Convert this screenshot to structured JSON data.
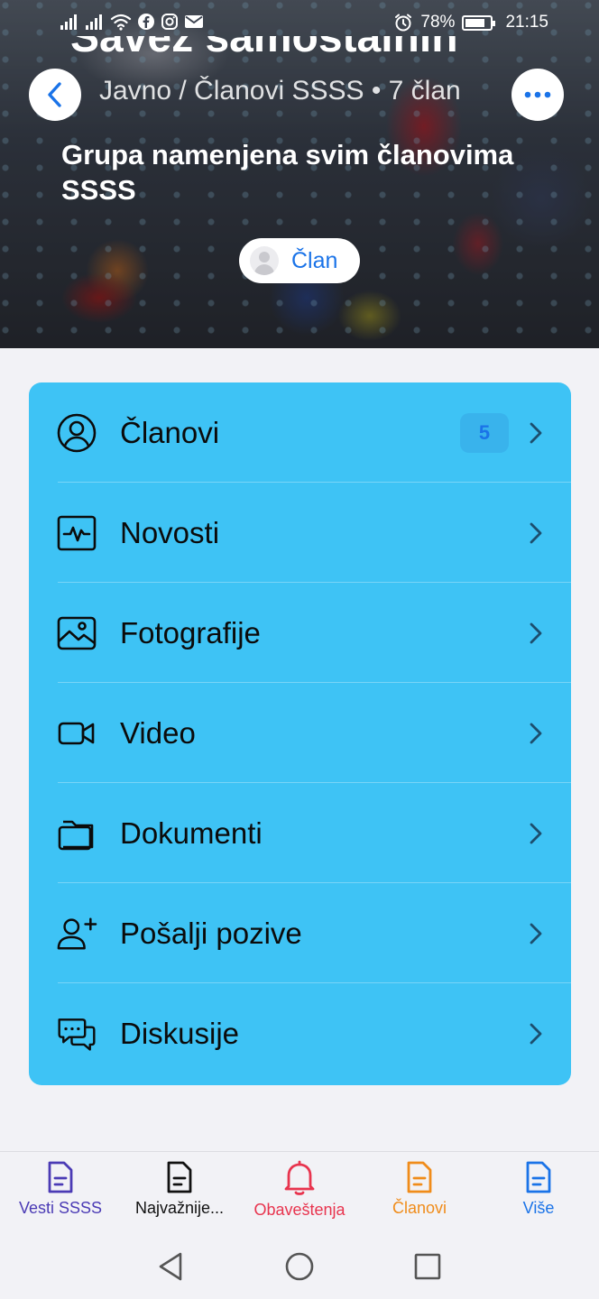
{
  "status_bar": {
    "battery_percent": "78%",
    "battery_level": 0.78,
    "time": "21:15",
    "icons": [
      "signal-icon",
      "signal-icon",
      "wifi-icon",
      "facebook-icon",
      "instagram-icon",
      "mail-icon",
      "alarm-icon",
      "battery-icon"
    ]
  },
  "header": {
    "cut_title": "Savez samostalnih",
    "breadcrumb": "Javno / Članovi SSSS • 7 član",
    "description": "Grupa namenjena svim članovima SSSS",
    "member_status": "Član",
    "accent": "#1a73e8"
  },
  "menu": {
    "background": "#3ec3f5",
    "items": [
      {
        "label": "Članovi",
        "icon": "user-circle-icon",
        "badge": "5"
      },
      {
        "label": "Novosti",
        "icon": "activity-icon"
      },
      {
        "label": "Fotografije",
        "icon": "image-icon"
      },
      {
        "label": "Video",
        "icon": "video-camera-icon"
      },
      {
        "label": "Dokumenti",
        "icon": "folder-icon"
      },
      {
        "label": "Pošalji pozive",
        "icon": "user-plus-icon"
      },
      {
        "label": "Diskusije",
        "icon": "chat-bubbles-icon"
      }
    ]
  },
  "tabbar": {
    "tabs": [
      {
        "label": "Vesti SSSS",
        "color": "#4b3bb5",
        "icon": "document-icon"
      },
      {
        "label": "Najvažnije...",
        "color": "#111111",
        "icon": "document-icon"
      },
      {
        "label": "Obaveštenja",
        "color": "#e8344e",
        "icon": "bell-icon"
      },
      {
        "label": "Članovi",
        "color": "#f08c1a",
        "icon": "document-icon"
      },
      {
        "label": "Više",
        "color": "#1a73e8",
        "icon": "document-icon"
      }
    ]
  },
  "system_nav": [
    "back-icon",
    "home-icon",
    "recents-icon"
  ]
}
